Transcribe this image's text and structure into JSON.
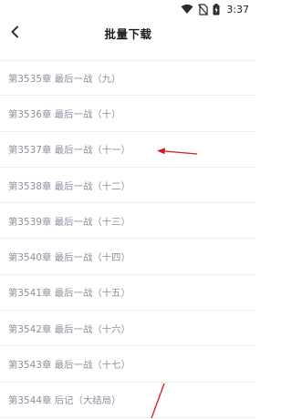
{
  "status_bar": {
    "time": "3:37",
    "icons": [
      "wifi-icon",
      "no-sim-icon",
      "battery-icon"
    ]
  },
  "header": {
    "title": "批量下载",
    "back_icon": "chevron-left-icon"
  },
  "chapters": [
    {
      "label": "第3535章 最后一战（九）"
    },
    {
      "label": "第3536章 最后一战（十）"
    },
    {
      "label": "第3537章 最后一战（十一）"
    },
    {
      "label": "第3538章 最后一战（十二）"
    },
    {
      "label": "第3539章 最后一战（十三）"
    },
    {
      "label": "第3540章 最后一战（十四）"
    },
    {
      "label": "第3541章 最后一战（十五）"
    },
    {
      "label": "第3542章 最后一战（十六）"
    },
    {
      "label": "第3543章 最后一战（十七）"
    },
    {
      "label": "第3544章 后记（大结局）"
    }
  ],
  "colors": {
    "annotation_red": "#d7191c",
    "chapter_text": "#8a8f9c",
    "divider": "#eeeeee"
  }
}
